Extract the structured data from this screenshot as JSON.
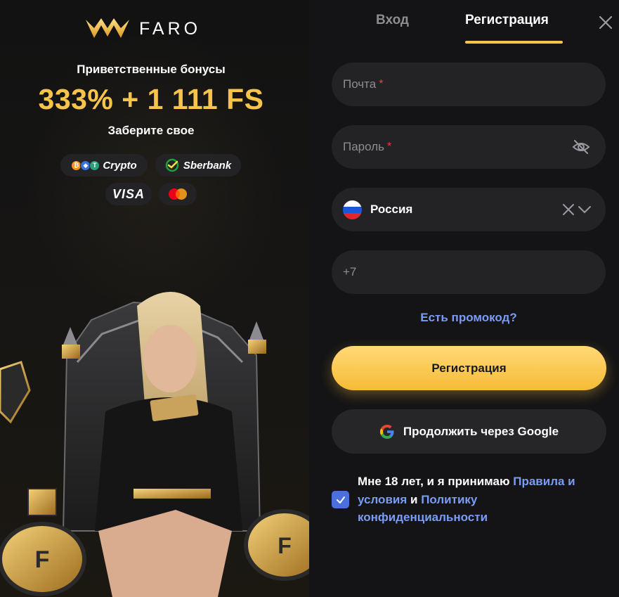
{
  "brand": {
    "name": "FARO"
  },
  "promo_panel": {
    "welcome_text": "Приветственные бонусы",
    "bonus_text": "333% + 1 111 FS",
    "claim_text": "Заберите свое",
    "payments": [
      {
        "label": "Crypto",
        "icon": "crypto-coins-icon"
      },
      {
        "label": "Sberbank",
        "icon": "sberbank-icon"
      },
      {
        "label": "VISA",
        "icon": "visa-icon"
      },
      {
        "label": "",
        "icon": "mastercard-icon"
      }
    ]
  },
  "tabs": {
    "login": "Вход",
    "register": "Регистрация",
    "active": "register"
  },
  "form": {
    "email_placeholder": "Почта",
    "password_placeholder": "Пароль",
    "required_mark": "*",
    "country": {
      "value": "Россия",
      "flag": "russia-flag-icon"
    },
    "phone_prefix": "+7",
    "promo_link": "Есть промокод?",
    "register_button": "Регистрация",
    "google_button": "Продолжить через Google",
    "terms": {
      "checked": true,
      "text_1": "Мне 18 лет, и я принимаю ",
      "link_rules": "Правила и условия",
      "text_2": " и ",
      "link_privacy": "Политику конфиденциальности"
    }
  },
  "colors": {
    "accent_gold": "#f7c44a",
    "link_blue": "#7b9cf4",
    "field_bg": "#232325",
    "page_bg": "#141416",
    "required_red": "#e5413d",
    "checkbox_blue": "#4c6fe0"
  }
}
